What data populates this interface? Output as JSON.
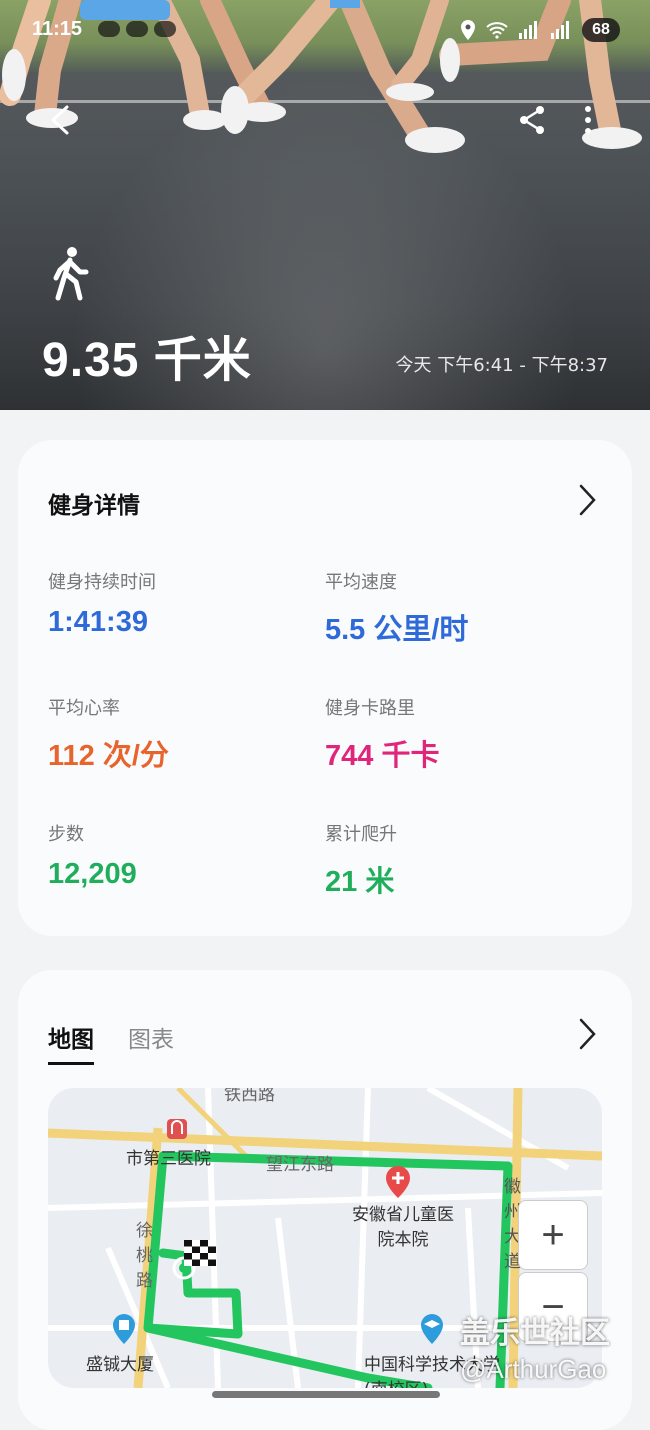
{
  "status_bar": {
    "time": "11:15",
    "battery": "68"
  },
  "hero": {
    "distance": "9.35 千米",
    "time_range": "今天 下午6:41 - 下午8:37"
  },
  "details_card": {
    "title": "健身详情",
    "metrics": [
      {
        "label": "健身持续时间",
        "value": "1:41:39",
        "color": "#2f6bd8"
      },
      {
        "label": "平均速度",
        "value": "5.5 公里/时",
        "color": "#2f6bd8"
      },
      {
        "label": "平均心率",
        "value": "112 次/分",
        "color": "#e8642d"
      },
      {
        "label": "健身卡路里",
        "value": "744 千卡",
        "color": "#e0267a"
      },
      {
        "label": "步数",
        "value": "12,209",
        "color": "#1fae5b"
      },
      {
        "label": "累计爬升",
        "value": "21 米",
        "color": "#1fae5b"
      }
    ]
  },
  "map_card": {
    "tabs": [
      {
        "label": "地图",
        "active": true
      },
      {
        "label": "图表",
        "active": false
      }
    ],
    "map_labels": {
      "top_road": "铁西路",
      "hospital_left": "市第三医院",
      "road_top": "望江东路",
      "childrens_hospital": "安徽省儿童医院本院",
      "road_left": "徐桃路",
      "building": "盛铖大厦",
      "university": "中国科学技术大学(南校区)",
      "road_right": "徽州大道"
    },
    "zoom_in": "+",
    "zoom_out": "−",
    "route_color": "#22c55e"
  },
  "watermark": {
    "line1": "盖乐世社区",
    "line2": "@ArthurGao"
  }
}
